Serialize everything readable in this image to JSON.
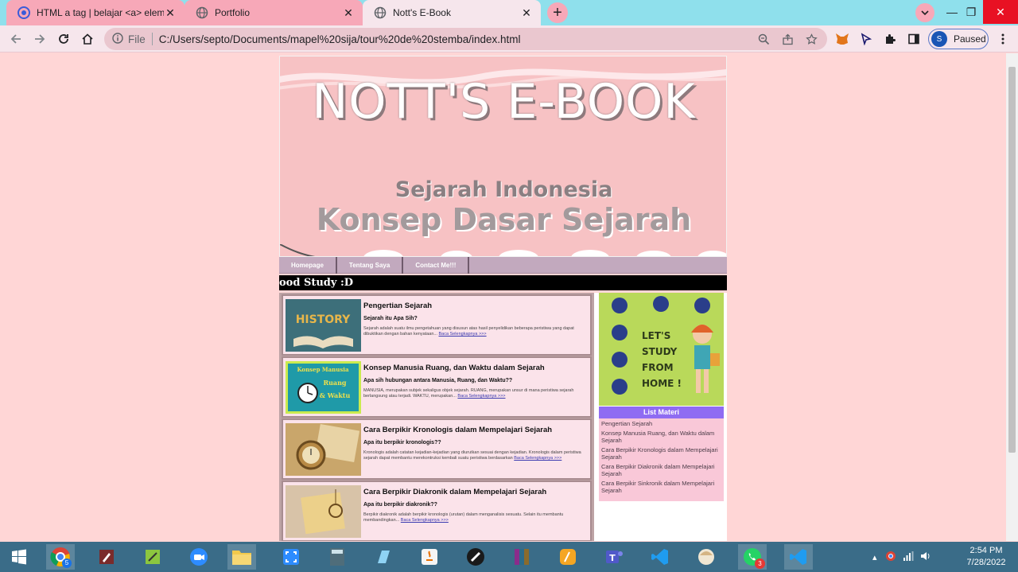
{
  "browser": {
    "tabs": [
      {
        "label": "HTML a tag | belajar <a> elemen",
        "icon": "chrome-logo-icon"
      },
      {
        "label": "Portfolio",
        "icon": "globe-icon"
      },
      {
        "label": "Nott's E-Book",
        "icon": "globe-icon"
      }
    ],
    "address": {
      "prefix": "File",
      "url": "C:/Users/septo/Documents/mapel%20sija/tour%20de%20stemba/index.html"
    },
    "profile": {
      "initial": "S",
      "status": "Paused"
    }
  },
  "page": {
    "header": {
      "title": "NOTT'S E-BOOK",
      "subtitle": "Sejarah Indonesia",
      "subtitle2": "Konsep Dasar Sejarah"
    },
    "nav": [
      "Homepage",
      "Tentang Saya",
      "Contact Me!!!"
    ],
    "marquee": "ood Study :D",
    "articles": [
      {
        "title": "Pengertian Sejarah",
        "subtitle": "Sejarah itu Apa Sih?",
        "desc": "Sejarah adalah suatu ilmu pengetahuan yang disusun atas hasil penyelidikan beberapa peristiwa yang dapat dibuktikan dengan bahan kenyataan...",
        "more": "Baca Selengkapnya >>>",
        "thumb_text": "HISTORY"
      },
      {
        "title": "Konsep Manusia Ruang, dan Waktu dalam Sejarah",
        "subtitle": "Apa sih hubungan antara Manusia, Ruang, dan Waktu??",
        "desc": "MANUSIA, merupakan subjek sekaligus objek sejarah. RUANG, merupakan unsur di mana peristiwa sejarah berlangsung atau terjadi. WAKTU, merupakan...",
        "more": "Baca Selengkapnya >>>",
        "thumb_text": [
          "Konsep Manusia",
          "Ruang",
          "& Waktu"
        ]
      },
      {
        "title": "Cara Berpikir Kronologis dalam Mempelajari Sejarah",
        "subtitle": "Apa itu berpikir kronologis??",
        "desc": "Kronologis adalah catatan kejadian-kejadian yang diurutkan sesuai dengan kejadian. Kronologis dalam peristiwa sejarah dapat membantu merekontruksi kembali suatu peristiwa berdasarkan",
        "more": "Baca Selengkapnya >>>"
      },
      {
        "title": "Cara Berpikir Diakronik dalam Mempelajari Sejarah",
        "subtitle": "Apa itu berpikir diakronik??",
        "desc": "Berpikir diakronik adalah berpikir kronologis (urutan) dalam menganalisis sesuatu. Selain itu membantu membandingkan...",
        "more": "Baca Selengkapnya >>>"
      }
    ],
    "sidebar": {
      "poster_text": [
        "LET'S",
        "STUDY",
        "FROM",
        "HOME !"
      ],
      "list_title": "List Materi",
      "items": [
        "Pengertian Sejarah",
        "Konsep Manusia Ruang, dan Waktu dalam Sejarah",
        "Cara Berpikir Kronologis dalam Mempelajari Sejarah",
        "Cara Berpikir Diakronik dalam Mempelajari Sejarah",
        "Cara Berpikir Sinkronik dalam Mempelajari Sejarah"
      ]
    }
  },
  "taskbar": {
    "time": "2:54 PM",
    "date": "7/28/2022",
    "badges": {
      "chrome": "5",
      "whatsapp": "3"
    }
  }
}
